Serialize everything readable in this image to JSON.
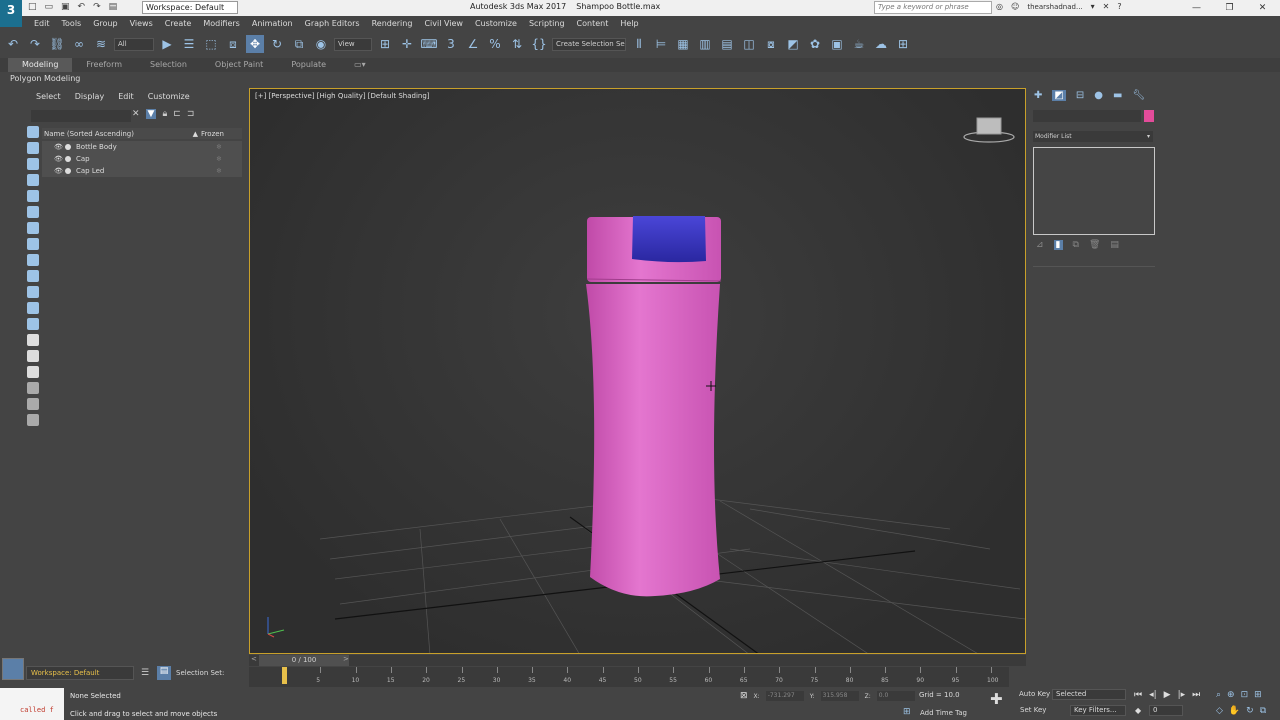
{
  "titlebar": {
    "workspace": "Workspace: Default",
    "title": "Autodesk 3ds Max 2017",
    "filename": "Shampoo Bottle.max",
    "search_placeholder": "Type a keyword or phrase",
    "username": "thearshadnad..."
  },
  "menubar": {
    "items": [
      "Edit",
      "Tools",
      "Group",
      "Views",
      "Create",
      "Modifiers",
      "Animation",
      "Graph Editors",
      "Rendering",
      "Civil View",
      "Customize",
      "Scripting",
      "Content",
      "Help"
    ]
  },
  "toolbar": {
    "filter": "All",
    "coord_system": "View",
    "named_selection": "Create Selection Se"
  },
  "ribbon": {
    "tabs": [
      "Modeling",
      "Freeform",
      "Selection",
      "Object Paint",
      "Populate"
    ],
    "active_tab": "Modeling",
    "sub_label": "Polygon Modeling"
  },
  "scene_explorer": {
    "menu": [
      "Select",
      "Display",
      "Edit",
      "Customize"
    ],
    "column_name": "Name (Sorted Ascending)",
    "column_frozen": "Frozen",
    "rows": [
      {
        "name": "Bottle Body"
      },
      {
        "name": "Cap"
      },
      {
        "name": "Cap Led"
      }
    ]
  },
  "viewport": {
    "label": "[+] [Perspective] [High Quality] [Default Shading]",
    "colors": {
      "bottle": "#e06dc8",
      "cap": "#3a36c0",
      "border": "#c8a02a"
    }
  },
  "command_panel": {
    "modifier_list": "Modifier List",
    "object_color": "#e34c9a"
  },
  "timeline": {
    "slider": "0 / 100",
    "ticks": [
      0,
      5,
      10,
      15,
      20,
      25,
      30,
      35,
      40,
      45,
      50,
      55,
      60,
      65,
      70,
      75,
      80,
      85,
      90,
      95,
      100
    ]
  },
  "status": {
    "workspace": "Workspace: Default",
    "selection_set": "Selection Set:",
    "maxscript": "called f",
    "selected": "None Selected",
    "prompt": "Click and drag to select and move objects",
    "x_label": "X:",
    "x_value": "-731.297",
    "y_label": "Y:",
    "y_value": "315.958",
    "z_label": "Z:",
    "z_value": "0.0",
    "grid": "Grid = 10.0",
    "add_time_tag": "Add Time Tag"
  },
  "animation": {
    "auto_key": "Auto Key",
    "set_key": "Set Key",
    "key_mode": "Selected",
    "key_filters": "Key Filters...",
    "frame": "0"
  }
}
